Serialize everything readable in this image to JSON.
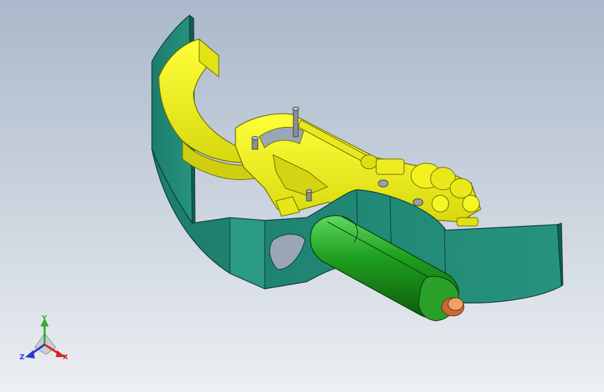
{
  "viewport": {
    "view": "isometric",
    "background_top": "#aab8cb",
    "background_bottom": "#eceff3"
  },
  "model": {
    "parts": [
      {
        "name": "guard-band",
        "color": "#1f8a78"
      },
      {
        "name": "main-frame",
        "color": "#f3f31a"
      },
      {
        "name": "cylinder-body",
        "color": "#1d8c1d"
      },
      {
        "name": "end-cap",
        "color": "#e4834a"
      },
      {
        "name": "pins",
        "color": "#8a8f93"
      }
    ]
  },
  "triad": {
    "y_label": "Y",
    "x_label": "X",
    "z_label": "Z",
    "y_color": "#2fae2f",
    "x_color": "#d82424",
    "z_color": "#2a36d4"
  }
}
